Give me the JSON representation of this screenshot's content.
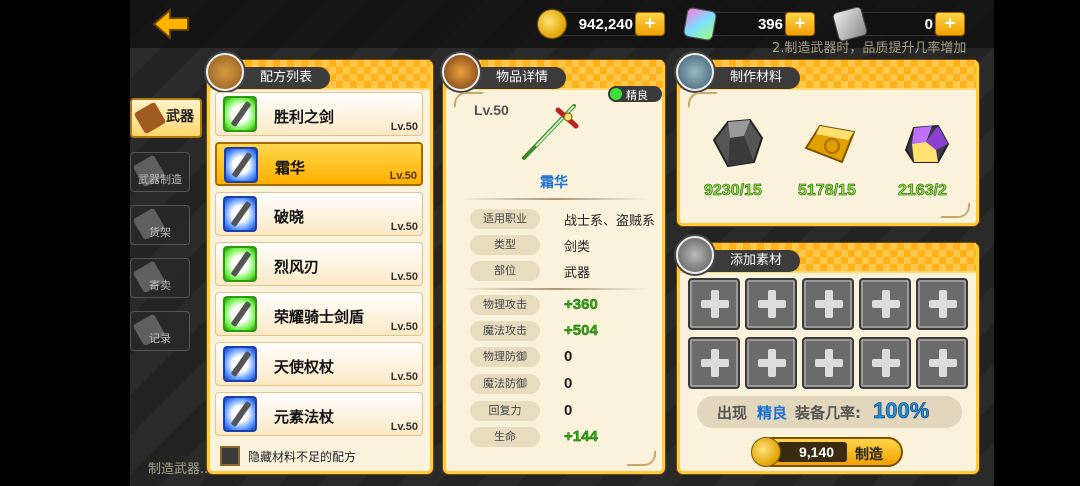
{
  "topbar": {
    "gold": "942,240",
    "gems": "396",
    "tickets": "0",
    "plus": "+"
  },
  "background_text": {
    "top_hint": "2.制造武器时，品质提升几率增加",
    "bottom_hint": "制造武器..."
  },
  "side_tabs": [
    {
      "label": "武器"
    },
    {
      "label": "武器制造"
    },
    {
      "label": "货架"
    },
    {
      "label": "寄卖"
    },
    {
      "label": "记录"
    }
  ],
  "recipe_panel": {
    "title": "配方列表",
    "items": [
      {
        "name": "胜利之剑",
        "level": "Lv.50",
        "rarity": "green"
      },
      {
        "name": "霜华",
        "level": "Lv.50",
        "rarity": "blue"
      },
      {
        "name": "破晓",
        "level": "Lv.50",
        "rarity": "blue"
      },
      {
        "name": "烈风刃",
        "level": "Lv.50",
        "rarity": "green"
      },
      {
        "name": "荣耀骑士剑盾",
        "level": "Lv.50",
        "rarity": "green"
      },
      {
        "name": "天使权杖",
        "level": "Lv.50",
        "rarity": "blue"
      },
      {
        "name": "元素法杖",
        "level": "Lv.50",
        "rarity": "blue"
      }
    ],
    "hide_label": "隐藏材料不足的配方"
  },
  "detail_panel": {
    "title": "物品详情",
    "level": "Lv.50",
    "quality": "精良",
    "item_name": "霜华",
    "info": [
      {
        "label": "适用职业",
        "value": "战士系、盗贼系"
      },
      {
        "label": "类型",
        "value": "剑类"
      },
      {
        "label": "部位",
        "value": "武器"
      }
    ],
    "stats": [
      {
        "label": "物理攻击",
        "value": "+360"
      },
      {
        "label": "魔法攻击",
        "value": "+504"
      },
      {
        "label": "物理防御",
        "value": "0"
      },
      {
        "label": "魔法防御",
        "value": "0"
      },
      {
        "label": "回复力",
        "value": "0"
      },
      {
        "label": "生命",
        "value": "+144"
      }
    ]
  },
  "materials_panel": {
    "title": "制作材料",
    "materials": [
      {
        "icon": "ore-icon",
        "count": "9230/15"
      },
      {
        "icon": "gold-ingot-icon",
        "count": "5178/15"
      },
      {
        "icon": "crystal-icon",
        "count": "2163/2"
      }
    ]
  },
  "add_panel": {
    "title": "添加素材",
    "slot_count": 10,
    "odds_prefix": "出现",
    "odds_quality": "精良",
    "odds_middle": "装备几率:",
    "odds_value": "100%",
    "make_cost": "9,140",
    "make_label": "制造"
  },
  "colors": {
    "accent": "#ffb000",
    "stat_green": "#2fb50e",
    "odds_blue": "#1f8fe0",
    "quality_blue": "#1a6fd8"
  }
}
